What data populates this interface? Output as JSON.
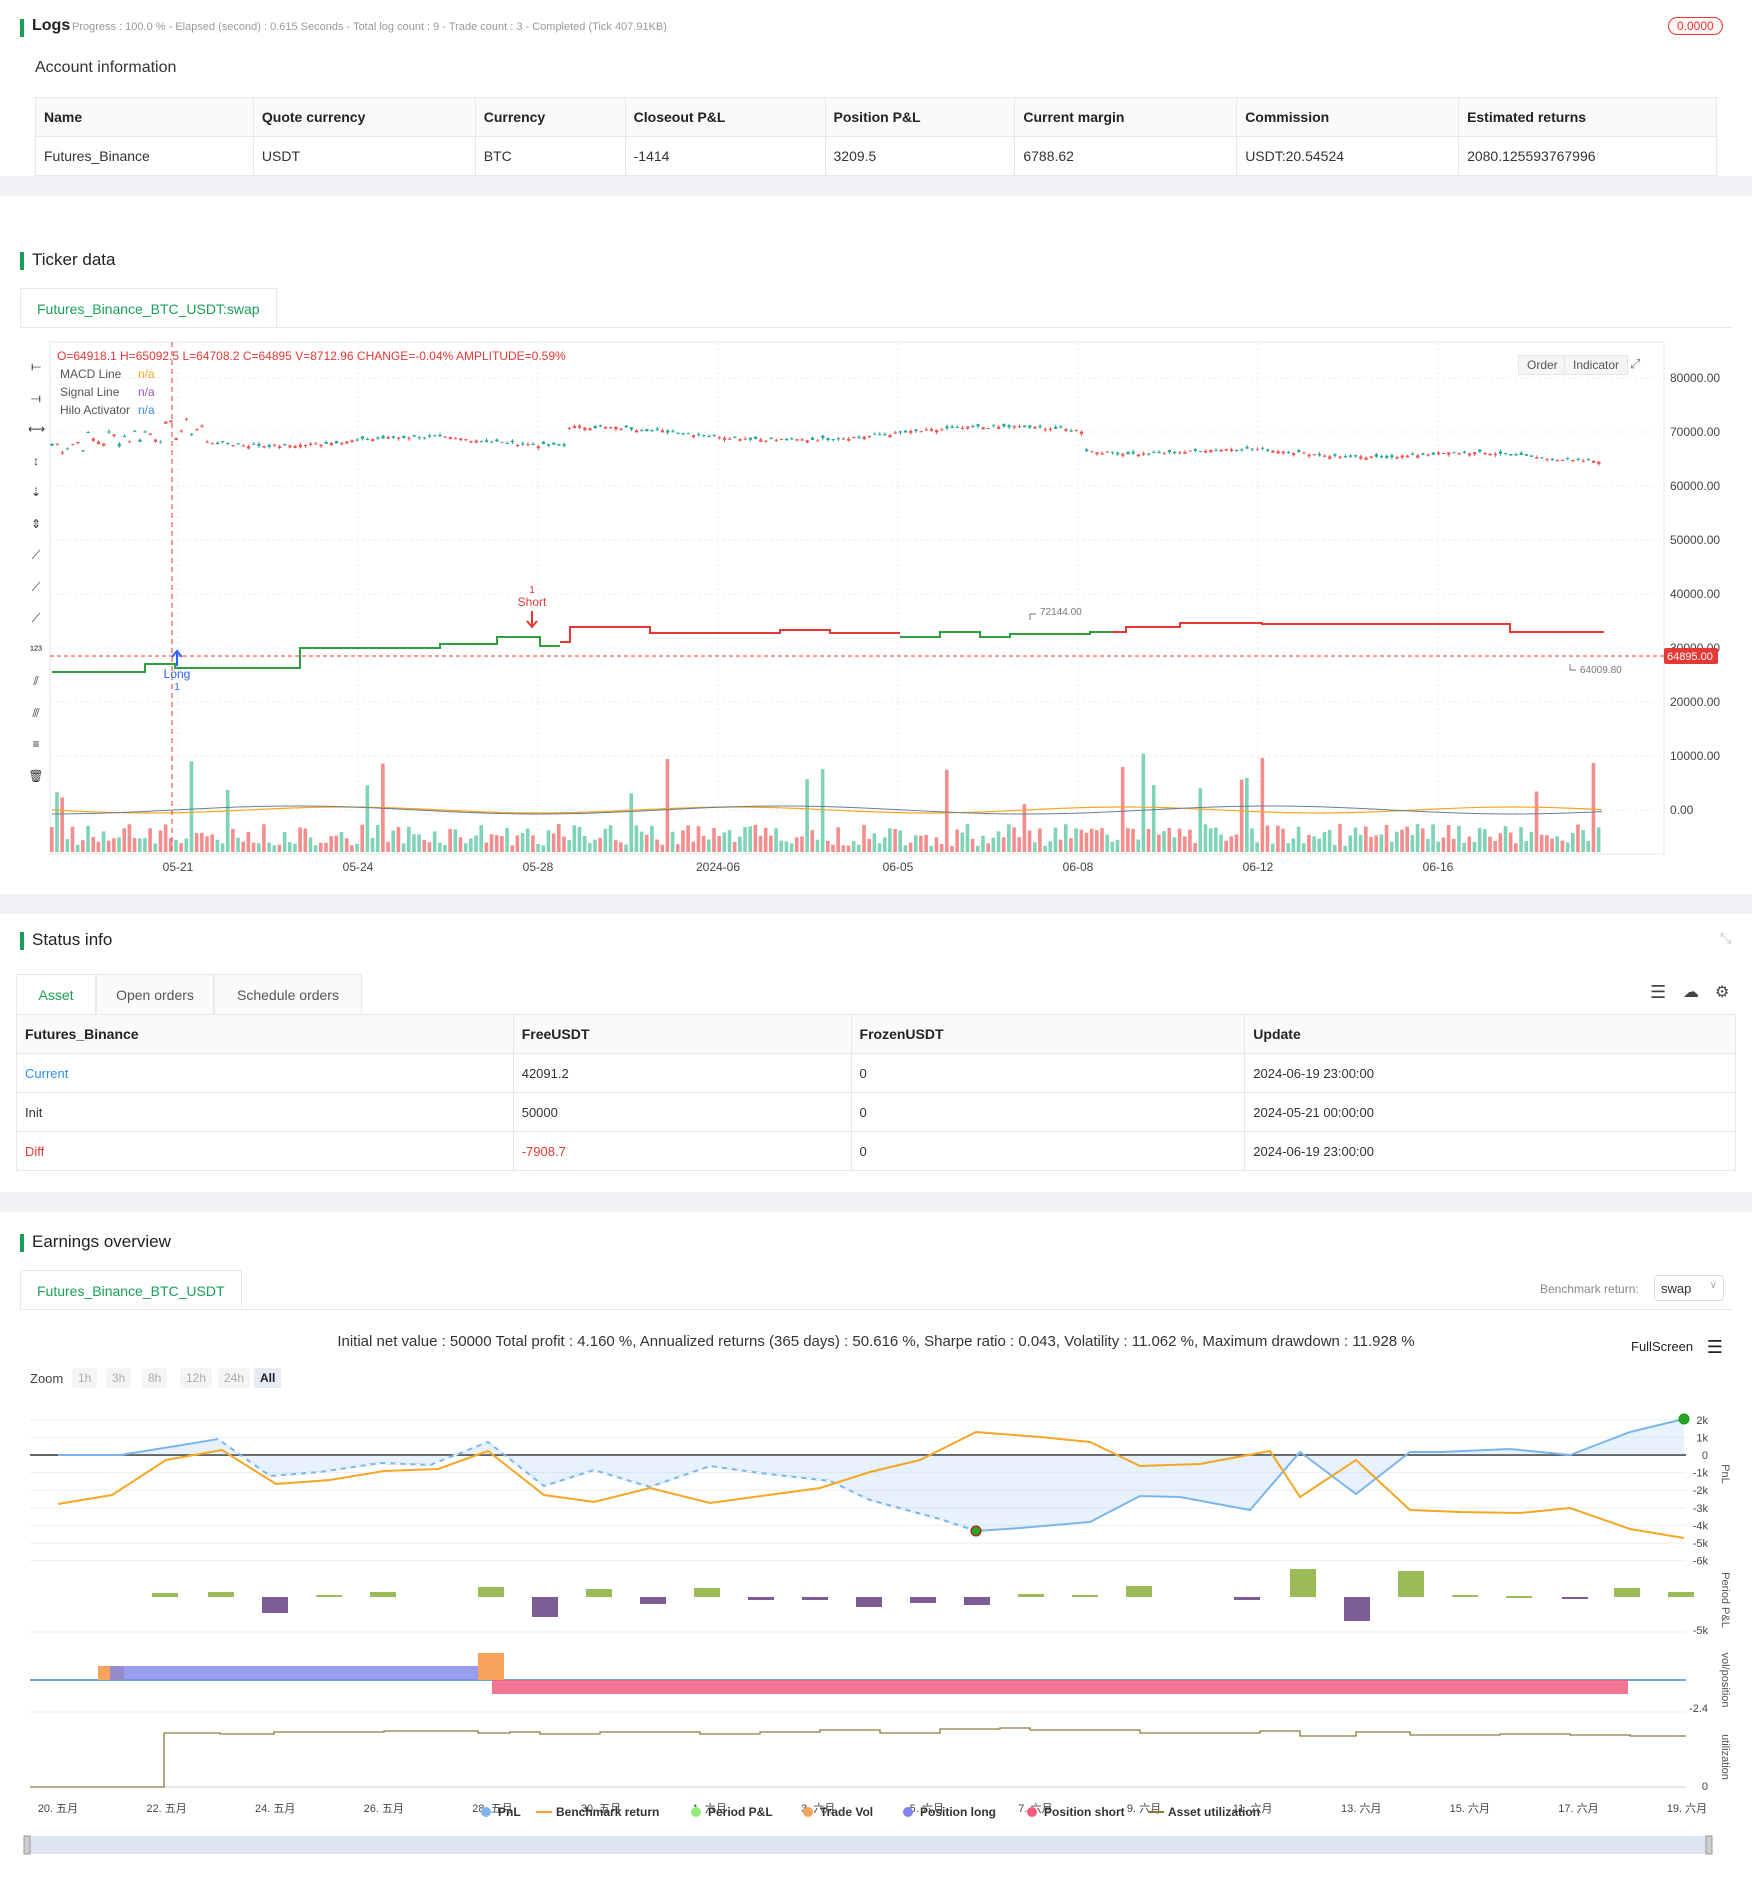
{
  "logs": {
    "title": "Logs",
    "progress": "Progress : 100.0 % - Elapsed (second) : 0.615  Seconds - Total log count : 9 - Trade count : 3 - Completed (Tick 407.91KB)",
    "badge": "0.0000"
  },
  "account": {
    "title": "Account information",
    "headers": [
      "Name",
      "Quote currency",
      "Currency",
      "Closeout P&L",
      "Position P&L",
      "Current margin",
      "Commission",
      "Estimated returns"
    ],
    "row": [
      "Futures_Binance",
      "USDT",
      "BTC",
      "-1414",
      "3209.5",
      "6788.62",
      "USDT:20.54524",
      "2080.125593767996"
    ]
  },
  "ticker": {
    "title": "Ticker data",
    "tab": "Futures_Binance_BTC_USDT:swap",
    "ohlc": "O=64918.1 H=65092.5 L=64708.2 C=64895 V=8712.96 CHANGE=-0.04% AMPLITUDE=0.59%",
    "legend": [
      {
        "name": "MACD Line",
        "value": "n/a",
        "color": "#f5a623"
      },
      {
        "name": "Signal Line",
        "value": "n/a",
        "color": "#9b59b6"
      },
      {
        "name": "Hilo Activator",
        "value": "n/a",
        "color": "#3d8bdf"
      }
    ],
    "buttons": {
      "order": "Order",
      "indicator": "Indicator"
    },
    "y_ticks": [
      "80000.00",
      "70000.00",
      "60000.00",
      "50000.00",
      "40000.00",
      "30000.00",
      "20000.00",
      "10000.00",
      "0.00"
    ],
    "x_ticks": [
      "05-21",
      "05-24",
      "05-28",
      "2024-06",
      "06-05",
      "06-08",
      "06-12",
      "06-16"
    ],
    "last_price": "64895.00",
    "high_marker": "72144.00",
    "low_marker": "64009.80",
    "signals": {
      "long_label": "Long",
      "long_count": "1",
      "short_label": "Short",
      "short_count": "1"
    },
    "tool_icons": [
      "horizontal-line-icon",
      "horizontal-ray-icon",
      "horizontal-segment-icon",
      "vertical-line-icon",
      "vertical-ray-icon",
      "vertical-segment-icon",
      "trend-line-icon",
      "ray-icon",
      "extended-line-icon",
      "price-label-icon",
      "parallel-channel-icon",
      "pitchfork-icon",
      "fib-retracement-icon",
      "trash-icon"
    ],
    "colors": {
      "up": "#26a69a",
      "down": "#ef5350",
      "hilo_green": "#2e9e3e",
      "hilo_red": "#e53935"
    }
  },
  "status": {
    "title": "Status info",
    "tabs": [
      "Asset",
      "Open orders",
      "Schedule orders"
    ],
    "headers": [
      "Futures_Binance",
      "FreeUSDT",
      "FrozenUSDT",
      "Update"
    ],
    "rows": [
      [
        "Current",
        "42091.2",
        "0",
        "2024-06-19 23:00:00"
      ],
      [
        "Init",
        "50000",
        "0",
        "2024-05-21 00:00:00"
      ],
      [
        "Diff",
        "-7908.7",
        "0",
        "2024-06-19 23:00:00"
      ]
    ]
  },
  "earnings": {
    "title": "Earnings overview",
    "tab": "Futures_Binance_BTC_USDT",
    "benchmark_label": "Benchmark return:",
    "benchmark_value": "swap",
    "summary": "Initial net value : 50000 Total profit : 4.160 %, Annualized returns (365 days) : 50.616 %, Sharpe ratio : 0.043, Volatility : 11.062 %, Maximum drawdown : 11.928 %",
    "fullscreen": "FullScreen",
    "zoom_label": "Zoom",
    "zoom_buttons": [
      "1h",
      "3h",
      "8h",
      "12h",
      "24h",
      "All"
    ],
    "pnl_ticks": [
      "2k",
      "1k",
      "0",
      "-1k",
      "-2k",
      "-3k",
      "-4k",
      "-5k",
      "-6k"
    ],
    "period_tick": "-5k",
    "vol_tick": "-2.4",
    "util_tick": "0",
    "axis_names": [
      "PnL",
      "Period P&L",
      "vol/position",
      "utilization"
    ],
    "x_ticks": [
      "20. 五月",
      "22. 五月",
      "24. 五月",
      "26. 五月",
      "28. 五月",
      "30. 五月",
      "1. 六月",
      "3. 六月",
      "5. 六月",
      "7. 六月",
      "9. 六月",
      "11. 六月",
      "13. 六月",
      "15. 六月",
      "17. 六月",
      "19. 六月"
    ],
    "legend": [
      {
        "name": "PnL",
        "color": "#7cb5ec"
      },
      {
        "name": "Benchmark return",
        "color": "#f5a623"
      },
      {
        "name": "Period P&L",
        "color": "#90ed7d"
      },
      {
        "name": "Trade Vol",
        "color": "#f7a35c"
      },
      {
        "name": "Position long",
        "color": "#8085e9"
      },
      {
        "name": "Position short",
        "color": "#f15c80"
      },
      {
        "name": "Asset utilization",
        "color": "#8d7a3a"
      }
    ]
  }
}
